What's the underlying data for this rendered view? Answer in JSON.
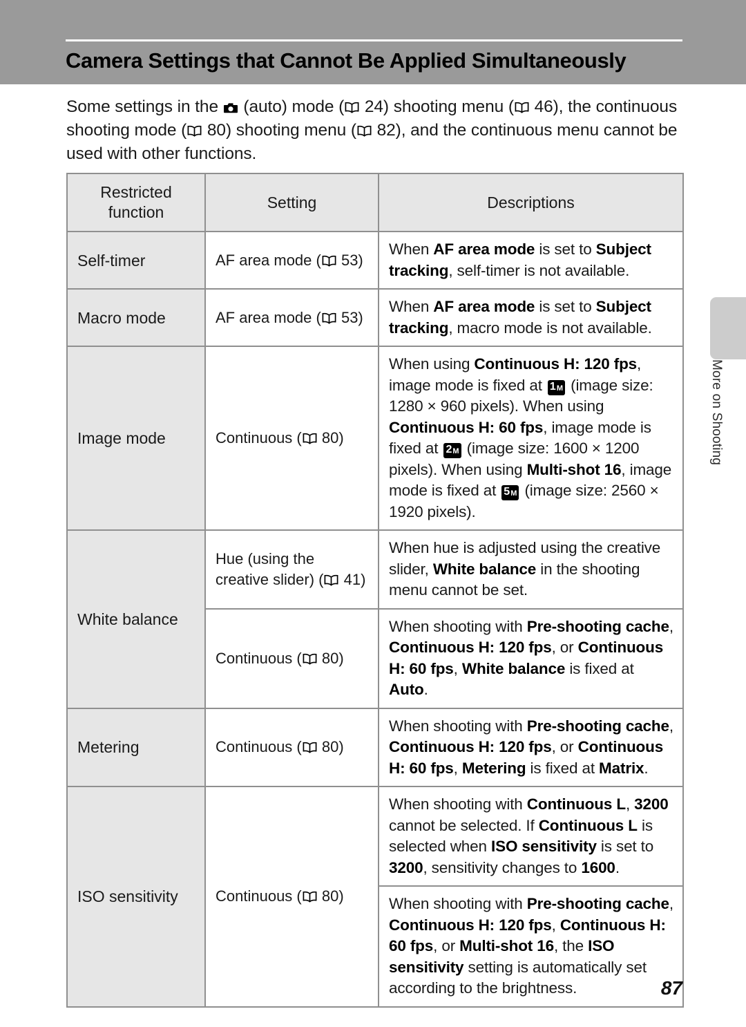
{
  "header": {
    "title": "Camera Settings that Cannot Be Applied Simultaneously"
  },
  "intro": {
    "part1": "Some settings in the ",
    "camera_icon": "camera-auto-icon",
    "part2": " (auto) mode (",
    "ref1": " 24) shooting menu (",
    "ref2": " 46), the continuous shooting mode (",
    "ref3": " 80) shooting menu (",
    "ref4": " 82), and the continuous menu cannot be used with other functions.",
    "page_refs": [
      "24",
      "46",
      "80",
      "82"
    ]
  },
  "table": {
    "headers": {
      "col1": "Restricted function",
      "col2": "Setting",
      "col3": "Descriptions"
    },
    "rows": [
      {
        "function": "Self-timer",
        "setting": "AF area mode (  53)",
        "setting_ref": "53",
        "setting_text": "AF area mode (",
        "setting_tail": " 53)",
        "desc_html": "When <b>AF area mode</b> is set to <b>Subject tracking</b>, self-timer is not available."
      },
      {
        "function": "Macro mode",
        "setting_text": "AF area mode (",
        "setting_ref": "53",
        "setting_tail": " 53)",
        "desc_html": "When <b>AF area mode</b> is set to <b>Subject tracking</b>, macro mode is not available."
      },
      {
        "function": "Image mode",
        "setting_text": "Continuous (",
        "setting_ref": "80",
        "setting_tail": " 80)",
        "desc_html": "When using <b>Continuous H: 120 fps</b>, image mode is fixed at [1M] (image size: 1280 × 960 pixels). When using <b>Continuous H: 60 fps</b>, image mode is fixed at [2M] (image size: 1600 × 1200 pixels). When using <b>Multi-shot 16</b>, image mode is fixed at [5M] (image size: 2560 × 1920 pixels)."
      },
      {
        "function": "White balance",
        "setting_text": "Hue (using the creative slider) (",
        "setting_ref": "41",
        "setting_tail": " 41)",
        "desc_html": "When hue is adjusted using the creative slider, <b>White balance</b> in the shooting menu cannot be set."
      },
      {
        "function": "",
        "setting_text": "Continuous (",
        "setting_ref": "80",
        "setting_tail": " 80)",
        "desc_html": "When shooting with <b>Pre-shooting cache</b>, <b>Continuous H: 120 fps</b>, or <b>Continuous H: 60 fps</b>, <b>White balance</b> is fixed at <b>Auto</b>."
      },
      {
        "function": "Metering",
        "setting_text": "Continuous (",
        "setting_ref": "80",
        "setting_tail": " 80)",
        "desc_html": "When shooting with <b>Pre-shooting cache</b>, <b>Continuous H: 120 fps</b>, or <b>Continuous H: 60 fps</b>, <b>Metering</b> is fixed at <b>Matrix</b>."
      },
      {
        "function": "ISO sensitivity",
        "setting_text": "Continuous (",
        "setting_ref": "80",
        "setting_tail": " 80)",
        "desc_html": "When shooting with <b>Continuous L</b>, <b>3200</b> cannot be selected. If <b>Continuous L</b> is selected when <b>ISO sensitivity</b> is set to <b>3200</b>, sensitivity changes to <b>1600</b>."
      },
      {
        "function": "",
        "setting_text": "",
        "desc_html": "When shooting with <b>Pre-shooting cache</b>, <b>Continuous H: 120 fps</b>, <b>Continuous H: 60 fps</b>, or <b>Multi-shot 16</b>, the <b>ISO sensitivity</b> setting is automatically set according to the brightness."
      }
    ]
  },
  "cells": {
    "r1_fn": "Self-timer",
    "r1_set_a": "AF area mode (",
    "r1_set_b": " 53)",
    "r2_fn": "Macro mode",
    "r2_set_a": "AF area mode (",
    "r2_set_b": " 53)",
    "r3_fn": "Image mode",
    "r3_set_a": "Continuous (",
    "r3_set_b": " 80)",
    "r4_fn": "White balance",
    "r4_set_a": "Hue (using the creative slider) (",
    "r4_set_b": " 41)",
    "r5_set_a": "Continuous (",
    "r5_set_b": " 80)",
    "r6_fn": "Metering",
    "r6_set_a": "Continuous (",
    "r6_set_b": " 80)",
    "r7_fn": "ISO sensitivity",
    "r7_set_a": "Continuous (",
    "r7_set_b": " 80)"
  },
  "desc_text": {
    "d1_a": "When ",
    "d1_b": "AF area mode",
    "d1_c": " is set to ",
    "d1_d": "Subject tracking",
    "d1_e": ", self-timer is not available.",
    "d2_e": ", macro mode is not available.",
    "d3_a": "When using ",
    "d3_b": "Continuous H: 120 fps",
    "d3_c": ", image mode is fixed at ",
    "d3_d": " (image size: 1280 × 960 pixels). When using ",
    "d3_e": "Continuous H: 60 fps",
    "d3_f": ", image mode is fixed at ",
    "d3_g": " (image size: 1600 × 1200 pixels). When using ",
    "d3_h": "Multi-shot 16",
    "d3_i": ", image mode is fixed at ",
    "d3_j": " (image size: 2560 × 1920 pixels).",
    "icon_1m": "1",
    "icon_1m_sub": "M",
    "icon_2m": "2",
    "icon_2m_sub": "M",
    "icon_5m": "5",
    "icon_5m_sub": "M",
    "d4_a": "When hue is adjusted using the creative slider, ",
    "d4_b": "White balance",
    "d4_c": " in the shooting menu cannot be set.",
    "d5_a": "When shooting with ",
    "d5_b": "Pre-shooting cache",
    "d5_c": ", ",
    "d5_d": "Continuous H: 120 fps",
    "d5_e": ", or ",
    "d5_f": "Continuous H: 60 fps",
    "d5_g": ", ",
    "d5_h": "White balance",
    "d5_i": " is fixed at ",
    "d5_j": "Auto",
    "d5_k": ".",
    "d6_h": "Metering",
    "d6_j": "Matrix",
    "d7_a": "When shooting with ",
    "d7_b": "Continuous L",
    "d7_c": ", ",
    "d7_d": "3200",
    "d7_e": " cannot be selected. If ",
    "d7_f": "Continuous L",
    "d7_g": " is selected when ",
    "d7_h": "ISO sensitivity",
    "d7_i": " is set to ",
    "d7_j": "3200",
    "d7_k": ", sensitivity changes to ",
    "d7_l": "1600",
    "d7_m": ".",
    "d8_a": "When shooting with ",
    "d8_b": "Pre-shooting cache",
    "d8_c": ", ",
    "d8_d": "Continuous H: 120 fps",
    "d8_e": ", ",
    "d8_f": "Continuous H: 60 fps",
    "d8_g": ", or ",
    "d8_h": "Multi-shot 16",
    "d8_i": ", the ",
    "d8_j": "ISO sensitivity",
    "d8_k": " setting is automatically set according to the brightness."
  },
  "side_tab": {
    "label": "More on Shooting"
  },
  "footer": {
    "page_number": "87"
  },
  "colors": {
    "header_band": "#9a9a9a",
    "table_header_bg": "#e6e6e6",
    "function_col_bg": "#e6e6e6",
    "border": "#8f8f8f",
    "side_tab": "#cccccc",
    "text": "#1a1a1a"
  }
}
